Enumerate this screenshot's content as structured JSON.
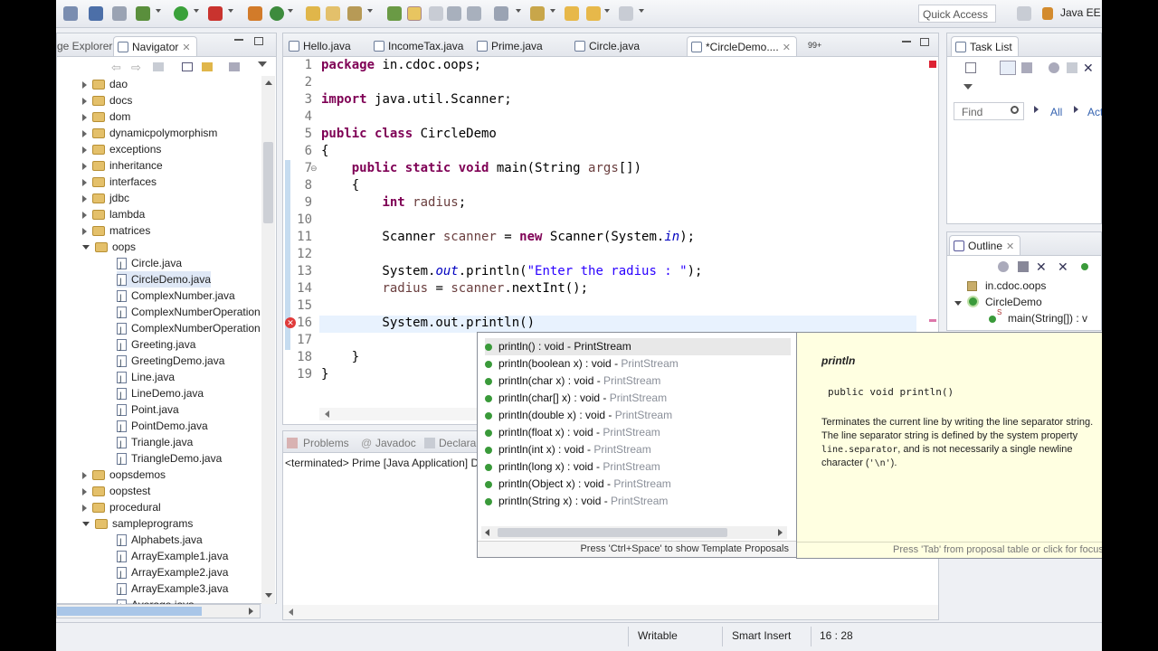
{
  "toolbar": {
    "quick_access_placeholder": "Quick Access",
    "perspective_label": "Java EE"
  },
  "navigator": {
    "tab_left_label": "ge Explorer",
    "tab_label": "Navigator",
    "items": [
      {
        "label": "dao",
        "type": "folder",
        "state": "collapsed",
        "level": 0
      },
      {
        "label": "docs",
        "type": "folder",
        "state": "collapsed",
        "level": 0
      },
      {
        "label": "dom",
        "type": "folder",
        "state": "collapsed",
        "level": 0
      },
      {
        "label": "dynamicpolymorphism",
        "type": "folder",
        "state": "collapsed",
        "level": 0
      },
      {
        "label": "exceptions",
        "type": "folder",
        "state": "collapsed",
        "level": 0
      },
      {
        "label": "inheritance",
        "type": "folder",
        "state": "collapsed",
        "level": 0
      },
      {
        "label": "interfaces",
        "type": "folder",
        "state": "collapsed",
        "level": 0
      },
      {
        "label": "jdbc",
        "type": "folder",
        "state": "collapsed",
        "level": 0
      },
      {
        "label": "lambda",
        "type": "folder",
        "state": "collapsed",
        "level": 0
      },
      {
        "label": "matrices",
        "type": "folder",
        "state": "collapsed",
        "level": 0
      },
      {
        "label": "oops",
        "type": "folder",
        "state": "expanded",
        "level": 0
      },
      {
        "label": "Circle.java",
        "type": "file",
        "level": 1
      },
      {
        "label": "CircleDemo.java",
        "type": "file",
        "level": 1,
        "selected": true
      },
      {
        "label": "ComplexNumber.java",
        "type": "file",
        "level": 1
      },
      {
        "label": "ComplexNumberOperation",
        "type": "file",
        "level": 1
      },
      {
        "label": "ComplexNumberOperation",
        "type": "file",
        "level": 1
      },
      {
        "label": "Greeting.java",
        "type": "file",
        "level": 1
      },
      {
        "label": "GreetingDemo.java",
        "type": "file",
        "level": 1
      },
      {
        "label": "Line.java",
        "type": "file",
        "level": 1
      },
      {
        "label": "LineDemo.java",
        "type": "file",
        "level": 1
      },
      {
        "label": "Point.java",
        "type": "file",
        "level": 1
      },
      {
        "label": "PointDemo.java",
        "type": "file",
        "level": 1
      },
      {
        "label": "Triangle.java",
        "type": "file",
        "level": 1
      },
      {
        "label": "TriangleDemo.java",
        "type": "file",
        "level": 1
      },
      {
        "label": "oopsdemos",
        "type": "folder",
        "state": "collapsed",
        "level": 0
      },
      {
        "label": "oopstest",
        "type": "folder",
        "state": "collapsed",
        "level": 0
      },
      {
        "label": "procedural",
        "type": "folder",
        "state": "collapsed",
        "level": 0
      },
      {
        "label": "sampleprograms",
        "type": "folder",
        "state": "expanded",
        "level": 0
      },
      {
        "label": "Alphabets.java",
        "type": "file",
        "level": 1
      },
      {
        "label": "ArrayExample1.java",
        "type": "file",
        "level": 1
      },
      {
        "label": "ArrayExample2.java",
        "type": "file",
        "level": 1
      },
      {
        "label": "ArrayExample3.java",
        "type": "file",
        "level": 1
      },
      {
        "label": "Average.java",
        "type": "file",
        "level": 1
      }
    ]
  },
  "editor": {
    "tabs": [
      {
        "label": "Hello.java"
      },
      {
        "label": "IncomeTax.java"
      },
      {
        "label": "Prime.java"
      },
      {
        "label": "Circle.java"
      },
      {
        "label": "*CircleDemo....",
        "active": true
      }
    ],
    "overflow_label": "99+",
    "lines": [
      {
        "n": "1",
        "tokens": [
          {
            "t": "package ",
            "c": "kw"
          },
          {
            "t": "in.cdoc.oops;",
            "c": ""
          }
        ]
      },
      {
        "n": "2",
        "tokens": []
      },
      {
        "n": "3",
        "tokens": [
          {
            "t": "import ",
            "c": "kw"
          },
          {
            "t": "java.util.Scanner;",
            "c": ""
          }
        ]
      },
      {
        "n": "4",
        "tokens": []
      },
      {
        "n": "5",
        "tokens": [
          {
            "t": "public class ",
            "c": "kw"
          },
          {
            "t": "CircleDemo",
            "c": ""
          }
        ]
      },
      {
        "n": "6",
        "tokens": [
          {
            "t": "{",
            "c": ""
          }
        ]
      },
      {
        "n": "7",
        "tokens": [
          {
            "t": "    ",
            "c": ""
          },
          {
            "t": "public static void ",
            "c": "kw"
          },
          {
            "t": "main(String ",
            "c": ""
          },
          {
            "t": "args",
            "c": "vr"
          },
          {
            "t": "[])",
            "c": ""
          }
        ]
      },
      {
        "n": "8",
        "tokens": [
          {
            "t": "    {",
            "c": ""
          }
        ]
      },
      {
        "n": "9",
        "tokens": [
          {
            "t": "        ",
            "c": ""
          },
          {
            "t": "int ",
            "c": "kw"
          },
          {
            "t": "radius",
            "c": "vr"
          },
          {
            "t": ";",
            "c": ""
          }
        ]
      },
      {
        "n": "10",
        "tokens": []
      },
      {
        "n": "11",
        "tokens": [
          {
            "t": "        Scanner ",
            "c": ""
          },
          {
            "t": "scanner",
            "c": "vr"
          },
          {
            "t": " = ",
            "c": ""
          },
          {
            "t": "new ",
            "c": "kw"
          },
          {
            "t": "Scanner(System.",
            "c": ""
          },
          {
            "t": "in",
            "c": "it"
          },
          {
            "t": ");",
            "c": ""
          }
        ]
      },
      {
        "n": "12",
        "tokens": []
      },
      {
        "n": "13",
        "tokens": [
          {
            "t": "        System.",
            "c": ""
          },
          {
            "t": "out",
            "c": "it"
          },
          {
            "t": ".println(",
            "c": ""
          },
          {
            "t": "\"Enter the radius : \"",
            "c": "str"
          },
          {
            "t": ");",
            "c": ""
          }
        ]
      },
      {
        "n": "14",
        "tokens": [
          {
            "t": "        ",
            "c": ""
          },
          {
            "t": "radius",
            "c": "vr"
          },
          {
            "t": " = ",
            "c": ""
          },
          {
            "t": "scanner",
            "c": "vr"
          },
          {
            "t": ".nextInt();",
            "c": ""
          }
        ]
      },
      {
        "n": "15",
        "tokens": []
      },
      {
        "n": "16",
        "tokens": [
          {
            "t": "        System.out.println()",
            "c": ""
          }
        ]
      },
      {
        "n": "17",
        "tokens": []
      },
      {
        "n": "18",
        "tokens": [
          {
            "t": "    }",
            "c": ""
          }
        ]
      },
      {
        "n": "19",
        "tokens": [
          {
            "t": "}",
            "c": ""
          }
        ]
      }
    ]
  },
  "content_assist": {
    "proposals": [
      {
        "name": "println() : void",
        "owner": "PrintStream"
      },
      {
        "name": "println(boolean x) : void",
        "owner": "PrintStream"
      },
      {
        "name": "println(char x) : void",
        "owner": "PrintStream"
      },
      {
        "name": "println(char[] x) : void",
        "owner": "PrintStream"
      },
      {
        "name": "println(double x) : void",
        "owner": "PrintStream"
      },
      {
        "name": "println(float x) : void",
        "owner": "PrintStream"
      },
      {
        "name": "println(int x) : void",
        "owner": "PrintStream"
      },
      {
        "name": "println(long x) : void",
        "owner": "PrintStream"
      },
      {
        "name": "println(Object x) : void",
        "owner": "PrintStream"
      },
      {
        "name": "println(String x) : void",
        "owner": "PrintStream"
      }
    ],
    "hint": "Press 'Ctrl+Space' to show Template Proposals",
    "doc_title": "println",
    "doc_signature": "public void println()",
    "doc_text_part1": "Terminates the current line by writing the line separator string. The line separator string is defined by the system property ",
    "doc_code": "line.separator",
    "doc_text_part2": ", and is not necessarily a single newline character (",
    "doc_code2": "'\\n'",
    "doc_text_part3": ").",
    "doc_footer": "Press 'Tab' from proposal table or click for focus"
  },
  "bottom_panel": {
    "tabs": [
      "Problems",
      "Javadoc",
      "Declara"
    ],
    "console_text": "<terminated> Prime [Java Application] D"
  },
  "task_list": {
    "tab_label": "Task List",
    "find_placeholder": "Find",
    "all_label": "All",
    "activate_label": "Acti"
  },
  "outline": {
    "tab_label": "Outline",
    "items": [
      {
        "label": "in.cdoc.oops",
        "level": 0
      },
      {
        "label": "CircleDemo",
        "level": 0
      },
      {
        "label": "main(String[]) : v",
        "level": 1
      }
    ]
  },
  "status": {
    "writable": "Writable",
    "insert_mode": "Smart Insert",
    "position": "16 : 28"
  }
}
